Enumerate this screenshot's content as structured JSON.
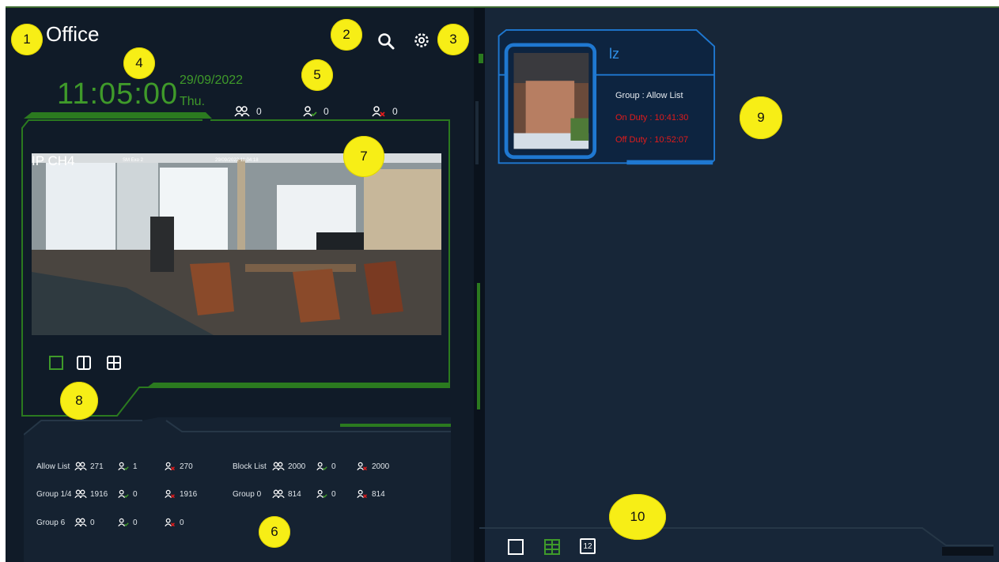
{
  "header": {
    "title": "Office",
    "time": "11:05:00",
    "date": "29/09/2022",
    "weekday": "Thu.",
    "counts": {
      "total": "0",
      "allowed": "0",
      "denied": "0"
    }
  },
  "camera": {
    "channel_label": "IP CH4",
    "overlay_name": "SM Exo 2",
    "overlay_time": "29/09/2022 11:04:18"
  },
  "groups": [
    {
      "name": "Allow List",
      "total": "271",
      "allowed": "1",
      "denied": "270"
    },
    {
      "name": "Block List",
      "total": "2000",
      "allowed": "0",
      "denied": "2000"
    },
    {
      "name": "Group 1/4",
      "total": "1916",
      "allowed": "0",
      "denied": "1916"
    },
    {
      "name": "Group 0",
      "total": "814",
      "allowed": "0",
      "denied": "814"
    },
    {
      "name": "Group 6",
      "total": "0",
      "allowed": "0",
      "denied": "0"
    }
  ],
  "card": {
    "name": "lz",
    "group": "Group  : Allow List",
    "on_duty": "On Duty  : 10:41:30",
    "off_duty": "Off Duty  : 10:52:07"
  },
  "right_layout": {
    "page_label": "12"
  },
  "badges": [
    "1",
    "2",
    "3",
    "4",
    "5",
    "6",
    "7",
    "8",
    "9",
    "10"
  ],
  "colors": {
    "accent_green": "#3f9a2a",
    "accent_blue": "#2f8fe6",
    "alert_red": "#e21b1b",
    "badge_yellow": "#f7ee16"
  },
  "icons": [
    "search-icon",
    "gear-icon",
    "people-icon",
    "person-check-icon",
    "person-deny-icon",
    "layout-single-icon",
    "layout-split-icon",
    "layout-quad-icon",
    "layout-grid-icon",
    "layout-12-icon"
  ]
}
